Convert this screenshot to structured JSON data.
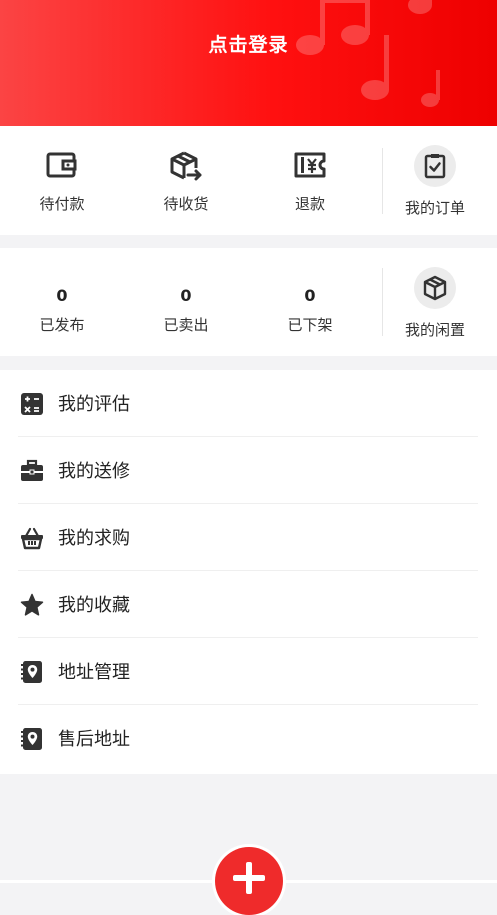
{
  "header": {
    "login_label": "点击登录"
  },
  "orders": {
    "items": [
      {
        "label": "待付款",
        "icon": "wallet-icon"
      },
      {
        "label": "待收货",
        "icon": "package-arrow-icon"
      },
      {
        "label": "退款",
        "icon": "refund-ticket-icon"
      }
    ],
    "my_orders": {
      "label": "我的订单",
      "icon": "clipboard-check-icon"
    }
  },
  "idle": {
    "stats": [
      {
        "value": "0",
        "label": "已发布"
      },
      {
        "value": "0",
        "label": "已卖出"
      },
      {
        "value": "0",
        "label": "已下架"
      }
    ],
    "my_idle": {
      "label": "我的闲置",
      "icon": "box-icon"
    }
  },
  "menu": [
    {
      "label": "我的评估",
      "icon": "calculator-icon"
    },
    {
      "label": "我的送修",
      "icon": "toolbox-icon"
    },
    {
      "label": "我的求购",
      "icon": "basket-icon"
    },
    {
      "label": "我的收藏",
      "icon": "star-icon"
    },
    {
      "label": "地址管理",
      "icon": "location-book-icon"
    },
    {
      "label": "售后地址",
      "icon": "location-book-icon"
    }
  ],
  "colors": {
    "brand_red": "#ff1a1a",
    "icon_dark": "#333333"
  }
}
